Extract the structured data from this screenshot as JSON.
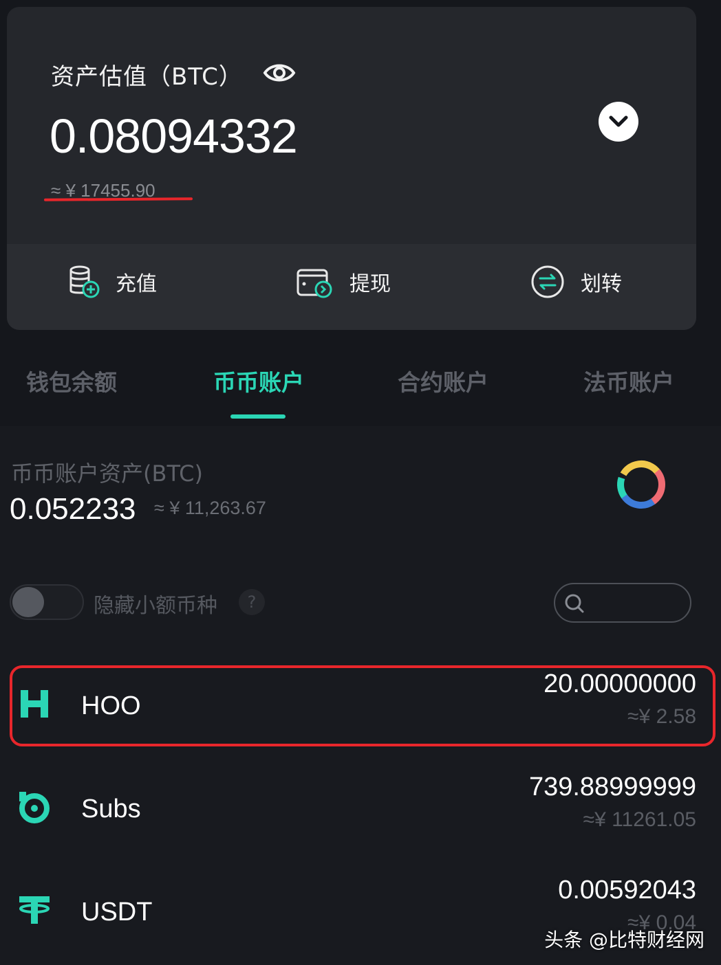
{
  "overview": {
    "label": "资产估值（BTC）",
    "value": "0.08094332",
    "cny": "≈ ¥ 17455.90"
  },
  "actions": [
    {
      "label": "充值",
      "icon": "deposit-icon"
    },
    {
      "label": "提现",
      "icon": "withdraw-icon"
    },
    {
      "label": "划转",
      "icon": "transfer-icon"
    }
  ],
  "tabs": [
    {
      "label": "钱包余额",
      "active": false
    },
    {
      "label": "币币账户",
      "active": true
    },
    {
      "label": "合约账户",
      "active": false
    },
    {
      "label": "法币账户",
      "active": false
    }
  ],
  "spot": {
    "label": "币币账户资产(BTC)",
    "value": "0.052233",
    "cny": "≈ ¥ 11,263.67"
  },
  "filter": {
    "hide_small_label": "隐藏小额币种",
    "help": "?",
    "search_placeholder": ""
  },
  "coins": [
    {
      "name": "HOO",
      "amount": "20.00000000",
      "cny": "≈¥ 2.58",
      "highlighted": true
    },
    {
      "name": "Subs",
      "amount": "739.88999999",
      "cny": "≈¥ 11261.05",
      "highlighted": false
    },
    {
      "name": "USDT",
      "amount": "0.00592043",
      "cny": "≈¥ 0.04",
      "highlighted": false
    }
  ],
  "watermark": "头条 @比特财经网",
  "colors": {
    "accent": "#2bd6b5",
    "highlight": "#e8262b",
    "background": "#15171c",
    "card": "#25272c"
  }
}
